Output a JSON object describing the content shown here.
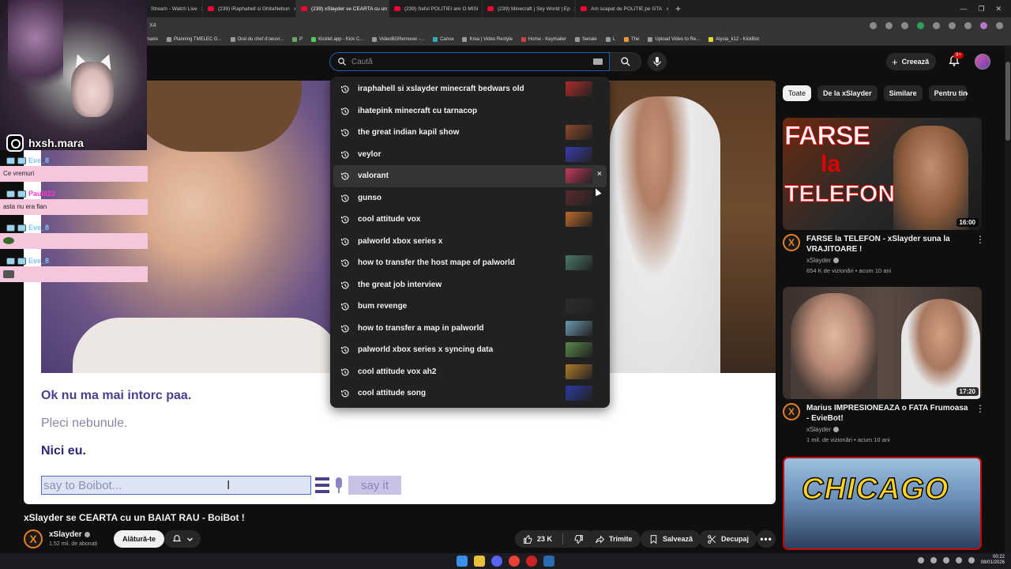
{
  "browser": {
    "tabs": [
      {
        "label": "Stream - Watch Live",
        "active": false
      },
      {
        "label": "(239) iRaphahell si GhitaNebun",
        "active": false
      },
      {
        "label": "(239) xSlayder se CEARTA cu un",
        "active": true
      },
      {
        "label": "(239) Seful POLITIEI are O MISI",
        "active": false
      },
      {
        "label": "(239) Minecraft | Sky World | Ep",
        "active": false
      },
      {
        "label": "Am scapat de POLITIE pe GTA",
        "active": false
      }
    ],
    "address_text": "X4",
    "bookmarks": [
      "maire",
      "Planning TMELEC G...",
      "Oral du chef d'oeuvr...",
      "P",
      "Kicklet.app - Kick C...",
      "VideoBGRemover -...",
      "Canva",
      "Krea | Video Restyle",
      "Home - Keymailer",
      "Seriale",
      "L",
      "The",
      "Upload Video to Re...",
      "Alysia_k12 - KickBot"
    ]
  },
  "header": {
    "search_placeholder": "Caută",
    "create_label": "Creează",
    "notif_badge": "9+"
  },
  "search_suggestions": [
    {
      "text": "iraphahell si xslayder minecraft bedwars old",
      "thumb": "#b22a2a"
    },
    {
      "text": "ihatepink minecraft cu tarnacop",
      "thumb": ""
    },
    {
      "text": "the great indian kapil show",
      "thumb": "#8a4a2c"
    },
    {
      "text": "veylor",
      "thumb": "#3a3ab0"
    },
    {
      "text": "valorant",
      "thumb": "#c23a5a",
      "hover": true
    },
    {
      "text": "gunso",
      "thumb": "#5a2a2a"
    },
    {
      "text": "cool attitude vox",
      "thumb": "#c06a2a"
    },
    {
      "text": "palworld xbox series x",
      "thumb": ""
    },
    {
      "text": "how to transfer the host mape of palworld",
      "thumb": "#4a7a6a"
    },
    {
      "text": "the great job interview",
      "thumb": ""
    },
    {
      "text": "bum revenge",
      "thumb": "#2c2c2c"
    },
    {
      "text": "how to transfer a map in palworld",
      "thumb": "#6a9ab0"
    },
    {
      "text": "palworld xbox series x syncing data",
      "thumb": "#5a8a4a"
    },
    {
      "text": "cool attitude vox ah2",
      "thumb": "#b07a2a"
    },
    {
      "text": "cool attitude song",
      "thumb": "#2a3aa0"
    }
  ],
  "remove_glyph": "×",
  "player": {
    "chat_lines": [
      "Ok nu ma mai intorc paa.",
      "Pleci nebunule.",
      "Nici eu."
    ],
    "bot_input_placeholder": "say to Boibot...",
    "say_button": "say it"
  },
  "video": {
    "title": "xSlayder se CEARTA cu un BAIAT RAU - BoiBot !",
    "channel": "xSlayder",
    "channel_initial": "X",
    "subscribers": "1,52 mil. de abonați",
    "join_label": "Alătură-te",
    "likes": "23 K",
    "share_label": "Trimite",
    "save_label": "Salvează",
    "clip_label": "Decupaj"
  },
  "sidebar": {
    "chips": [
      "Toate",
      "De la xSlayder",
      "Similare",
      "Pentru tine"
    ],
    "recommendations": [
      {
        "title": "FARSE la TELEFON - xSlayder suna la VRAJITOARE !",
        "channel": "xSlayder",
        "meta": "654 K de vizionări • acum 10 ani",
        "duration": "16:00",
        "thumb_text": [
          "FARSE",
          "la",
          "TELEFON"
        ]
      },
      {
        "title": "Marius IMPRESIONEAZA o FATA Frumoasa - EvieBot!",
        "channel": "xSlayder",
        "meta": "1 mil. de vizionări • acum 10 ani",
        "duration": "17:20"
      },
      {
        "thumb_text": [
          "CHICAGO"
        ]
      }
    ]
  },
  "overlay": {
    "instagram_handle": "hxsh.mara",
    "chat": [
      {
        "user": "Eve_8",
        "color": "#7ac7ff",
        "message": "Ce vremuri"
      },
      {
        "user": "Paul822",
        "color": "#ff3ad0",
        "message": "asta nu era fian"
      },
      {
        "user": "Eve_8",
        "color": "#7ac7ff",
        "message": ""
      },
      {
        "user": "Eve_8",
        "color": "#7ac7ff",
        "message": ""
      }
    ]
  },
  "taskbar": {
    "time": "00:22",
    "date": "08/01/2026"
  }
}
